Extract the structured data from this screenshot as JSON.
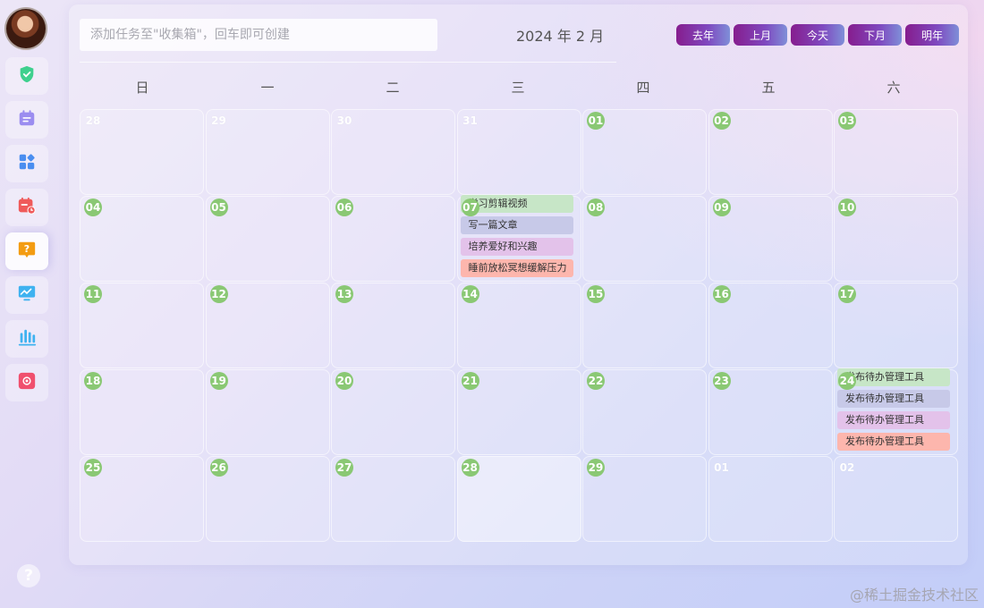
{
  "sidebar": {
    "items": [
      {
        "name": "shield",
        "color": "#3fd08e"
      },
      {
        "name": "calendar",
        "color": "#9b8df0"
      },
      {
        "name": "apps",
        "color": "#4a8ef0"
      },
      {
        "name": "calendar-clock",
        "color": "#ef5a5a"
      },
      {
        "name": "question",
        "color": "#f39c12",
        "active": true
      },
      {
        "name": "monitor-chart",
        "color": "#3fb2f0"
      },
      {
        "name": "bar-chart",
        "color": "#3fb2f0"
      },
      {
        "name": "flower-badge",
        "color": "#f0506e"
      }
    ],
    "help_label": "?"
  },
  "header": {
    "input_placeholder": "添加任务至\"收集箱\"，回车即可创建",
    "month_title": "2024 年 2 月",
    "buttons": [
      "去年",
      "上月",
      "今天",
      "下月",
      "明年"
    ]
  },
  "weekdays": [
    "日",
    "一",
    "二",
    "三",
    "四",
    "五",
    "六"
  ],
  "weeks": [
    [
      {
        "d": "28",
        "cur": false
      },
      {
        "d": "29",
        "cur": false
      },
      {
        "d": "30",
        "cur": false
      },
      {
        "d": "31",
        "cur": false
      },
      {
        "d": "01",
        "cur": true
      },
      {
        "d": "02",
        "cur": true
      },
      {
        "d": "03",
        "cur": true
      }
    ],
    [
      {
        "d": "04",
        "cur": true
      },
      {
        "d": "05",
        "cur": true
      },
      {
        "d": "06",
        "cur": true
      },
      {
        "d": "07",
        "cur": true,
        "events": [
          {
            "text": "学习剪辑视频",
            "color": "#c7e6c7"
          },
          {
            "text": "写一篇文章",
            "color": "#c7c9e8"
          },
          {
            "text": "培养爱好和兴趣",
            "color": "#e3c2ea"
          },
          {
            "text": "睡前放松冥想缓解压力",
            "color": "#fdb6ad"
          }
        ]
      },
      {
        "d": "08",
        "cur": true
      },
      {
        "d": "09",
        "cur": true
      },
      {
        "d": "10",
        "cur": true
      }
    ],
    [
      {
        "d": "11",
        "cur": true
      },
      {
        "d": "12",
        "cur": true
      },
      {
        "d": "13",
        "cur": true
      },
      {
        "d": "14",
        "cur": true
      },
      {
        "d": "15",
        "cur": true
      },
      {
        "d": "16",
        "cur": true
      },
      {
        "d": "17",
        "cur": true
      }
    ],
    [
      {
        "d": "18",
        "cur": true
      },
      {
        "d": "19",
        "cur": true
      },
      {
        "d": "20",
        "cur": true
      },
      {
        "d": "21",
        "cur": true
      },
      {
        "d": "22",
        "cur": true
      },
      {
        "d": "23",
        "cur": true
      },
      {
        "d": "24",
        "cur": true,
        "events": [
          {
            "text": "发布待办管理工具",
            "color": "#c7e6c7"
          },
          {
            "text": "发布待办管理工具",
            "color": "#c7c9e8"
          },
          {
            "text": "发布待办管理工具",
            "color": "#e3c2ea"
          },
          {
            "text": "发布待办管理工具",
            "color": "#fdb6ad"
          }
        ]
      }
    ],
    [
      {
        "d": "25",
        "cur": true
      },
      {
        "d": "26",
        "cur": true
      },
      {
        "d": "27",
        "cur": true
      },
      {
        "d": "28",
        "cur": true,
        "today": true
      },
      {
        "d": "29",
        "cur": true
      },
      {
        "d": "01",
        "cur": false
      },
      {
        "d": "02",
        "cur": false
      }
    ]
  ],
  "watermark": "@稀土掘金技术社区"
}
